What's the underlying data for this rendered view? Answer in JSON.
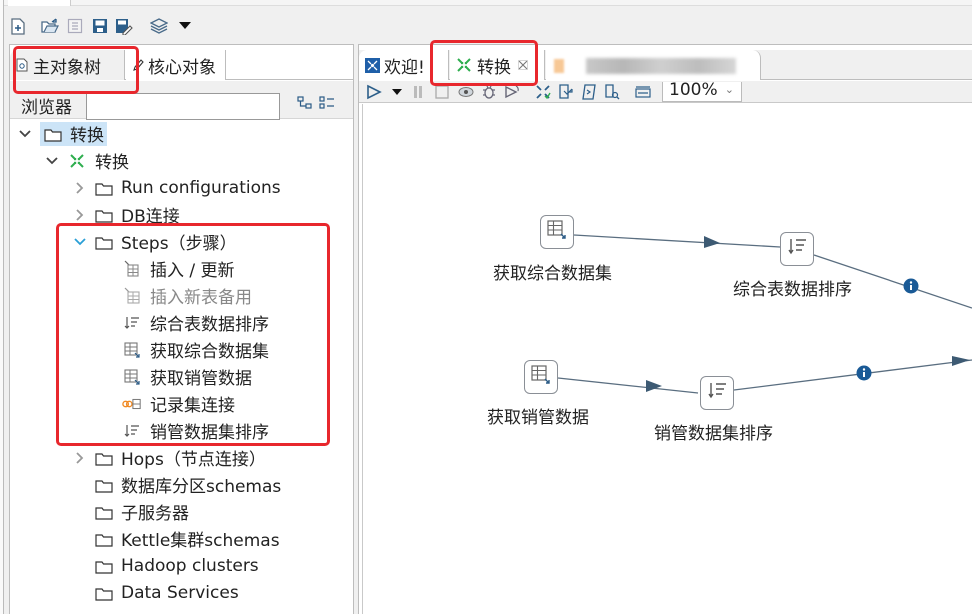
{
  "main_toolbar": {
    "icons": [
      "new-file-icon",
      "open-file-icon",
      "explore-repository-icon",
      "save-icon",
      "save-as-icon",
      "perspective-layers-icon",
      "dropdown-arrow-icon"
    ]
  },
  "left_panel": {
    "tabs": [
      {
        "label": "主对象树",
        "icon": "view-icon",
        "active": true
      },
      {
        "label": "核心对象",
        "icon": "pencil-icon",
        "active": false
      }
    ],
    "browser_label": "浏览器",
    "search_value": "",
    "tree": {
      "root": {
        "label": "转换",
        "expanded": true,
        "selected": true
      },
      "transformation": {
        "label": "转换",
        "expanded": true
      },
      "folders_top": [
        {
          "label": "Run configurations",
          "expandable": true,
          "expanded": false
        },
        {
          "label": "DB连接",
          "expandable": true,
          "expanded": false
        }
      ],
      "steps_folder": {
        "label": "Steps（步骤）",
        "expanded": true
      },
      "steps": [
        {
          "label": "插入 / 更新",
          "icon": "insert-update-icon",
          "disabled": false
        },
        {
          "label": "插入新表备用",
          "icon": "table-output-icon",
          "disabled": true
        },
        {
          "label": "综合表数据排序",
          "icon": "sort-rows-icon",
          "disabled": false
        },
        {
          "label": "获取综合数据集",
          "icon": "table-input-icon",
          "disabled": false
        },
        {
          "label": "获取销管数据",
          "icon": "table-input-icon",
          "disabled": false
        },
        {
          "label": "记录集连接",
          "icon": "merge-join-icon",
          "disabled": false
        },
        {
          "label": "销管数据集排序",
          "icon": "sort-rows-icon",
          "disabled": false
        }
      ],
      "folders_bottom": [
        {
          "label": "Hops（节点连接）",
          "expandable": true
        },
        {
          "label": "数据库分区schemas",
          "expandable": false
        },
        {
          "label": "子服务器",
          "expandable": false
        },
        {
          "label": "Kettle集群schemas",
          "expandable": false
        },
        {
          "label": "Hadoop clusters",
          "expandable": false
        },
        {
          "label": "Data Services",
          "expandable": false
        }
      ]
    }
  },
  "editor": {
    "tabs": [
      {
        "label": "欢迎!",
        "icon": "welcome-icon",
        "active": false,
        "closable": false
      },
      {
        "label": "转换",
        "icon": "transformation-icon",
        "active": true,
        "closable": true
      },
      {
        "label": "",
        "icon": "transformation-icon",
        "active": false,
        "blurred": true
      }
    ],
    "toolbar": {
      "icons": [
        "run-icon",
        "run-dropdown-icon",
        "pause-icon",
        "stop-icon",
        "preview-icon",
        "debug-icon",
        "replay-icon",
        "verify-icon",
        "impact-analysis-icon",
        "sql-icon",
        "explore-db-icon",
        "grid-align-icon"
      ],
      "zoom_value": "100%"
    },
    "canvas": {
      "steps": [
        {
          "id": "s1",
          "label": "获取综合数据集",
          "type": "table-input"
        },
        {
          "id": "s2",
          "label": "综合表数据排序",
          "type": "sort-rows"
        },
        {
          "id": "s3",
          "label": "获取销管数据",
          "type": "table-input"
        },
        {
          "id": "s4",
          "label": "销管数据集排序",
          "type": "sort-rows"
        }
      ],
      "hops": [
        {
          "from": "获取综合数据集",
          "to": "综合表数据排序",
          "info_badge": false
        },
        {
          "from": "综合表数据排序",
          "to": "记录集连接",
          "info_badge": true
        },
        {
          "from": "获取销管数据",
          "to": "销管数据集排序",
          "info_badge": false
        },
        {
          "from": "销管数据集排序",
          "to": "记录集连接",
          "info_badge": true
        }
      ]
    }
  },
  "colors": {
    "highlight_box": "#e8272d",
    "hop_line": "#5a6e80",
    "hop_arrow": "#3d5a73",
    "info_badge": "#1a5a96",
    "selection_bg": "#cce4f7",
    "transformation_icon": "#2fae4f"
  }
}
